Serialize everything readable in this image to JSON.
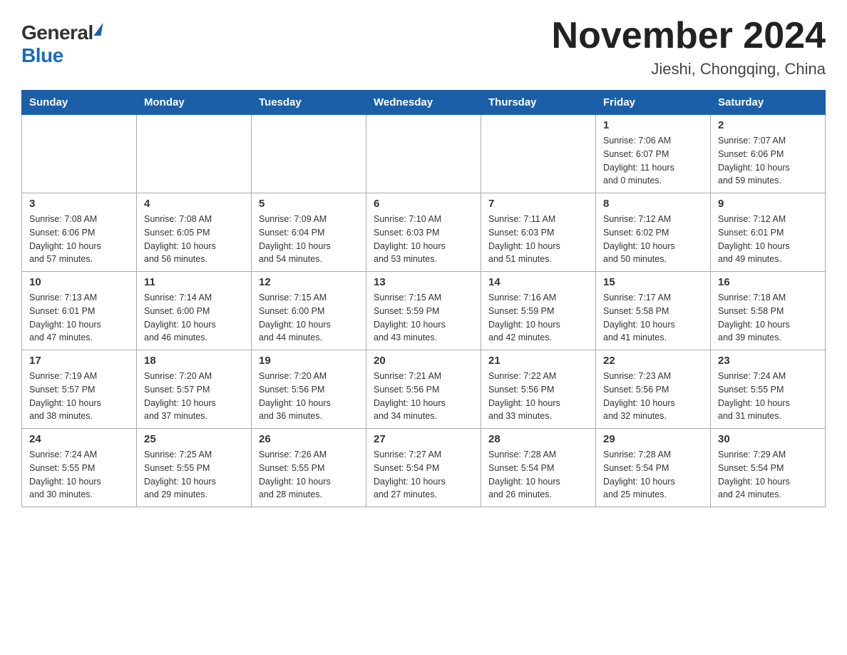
{
  "header": {
    "logo_general": "General",
    "logo_blue": "Blue",
    "month_title": "November 2024",
    "location": "Jieshi, Chongqing, China"
  },
  "weekdays": [
    "Sunday",
    "Monday",
    "Tuesday",
    "Wednesday",
    "Thursday",
    "Friday",
    "Saturday"
  ],
  "weeks": [
    [
      {
        "day": "",
        "info": ""
      },
      {
        "day": "",
        "info": ""
      },
      {
        "day": "",
        "info": ""
      },
      {
        "day": "",
        "info": ""
      },
      {
        "day": "",
        "info": ""
      },
      {
        "day": "1",
        "info": "Sunrise: 7:06 AM\nSunset: 6:07 PM\nDaylight: 11 hours\nand 0 minutes."
      },
      {
        "day": "2",
        "info": "Sunrise: 7:07 AM\nSunset: 6:06 PM\nDaylight: 10 hours\nand 59 minutes."
      }
    ],
    [
      {
        "day": "3",
        "info": "Sunrise: 7:08 AM\nSunset: 6:06 PM\nDaylight: 10 hours\nand 57 minutes."
      },
      {
        "day": "4",
        "info": "Sunrise: 7:08 AM\nSunset: 6:05 PM\nDaylight: 10 hours\nand 56 minutes."
      },
      {
        "day": "5",
        "info": "Sunrise: 7:09 AM\nSunset: 6:04 PM\nDaylight: 10 hours\nand 54 minutes."
      },
      {
        "day": "6",
        "info": "Sunrise: 7:10 AM\nSunset: 6:03 PM\nDaylight: 10 hours\nand 53 minutes."
      },
      {
        "day": "7",
        "info": "Sunrise: 7:11 AM\nSunset: 6:03 PM\nDaylight: 10 hours\nand 51 minutes."
      },
      {
        "day": "8",
        "info": "Sunrise: 7:12 AM\nSunset: 6:02 PM\nDaylight: 10 hours\nand 50 minutes."
      },
      {
        "day": "9",
        "info": "Sunrise: 7:12 AM\nSunset: 6:01 PM\nDaylight: 10 hours\nand 49 minutes."
      }
    ],
    [
      {
        "day": "10",
        "info": "Sunrise: 7:13 AM\nSunset: 6:01 PM\nDaylight: 10 hours\nand 47 minutes."
      },
      {
        "day": "11",
        "info": "Sunrise: 7:14 AM\nSunset: 6:00 PM\nDaylight: 10 hours\nand 46 minutes."
      },
      {
        "day": "12",
        "info": "Sunrise: 7:15 AM\nSunset: 6:00 PM\nDaylight: 10 hours\nand 44 minutes."
      },
      {
        "day": "13",
        "info": "Sunrise: 7:15 AM\nSunset: 5:59 PM\nDaylight: 10 hours\nand 43 minutes."
      },
      {
        "day": "14",
        "info": "Sunrise: 7:16 AM\nSunset: 5:59 PM\nDaylight: 10 hours\nand 42 minutes."
      },
      {
        "day": "15",
        "info": "Sunrise: 7:17 AM\nSunset: 5:58 PM\nDaylight: 10 hours\nand 41 minutes."
      },
      {
        "day": "16",
        "info": "Sunrise: 7:18 AM\nSunset: 5:58 PM\nDaylight: 10 hours\nand 39 minutes."
      }
    ],
    [
      {
        "day": "17",
        "info": "Sunrise: 7:19 AM\nSunset: 5:57 PM\nDaylight: 10 hours\nand 38 minutes."
      },
      {
        "day": "18",
        "info": "Sunrise: 7:20 AM\nSunset: 5:57 PM\nDaylight: 10 hours\nand 37 minutes."
      },
      {
        "day": "19",
        "info": "Sunrise: 7:20 AM\nSunset: 5:56 PM\nDaylight: 10 hours\nand 36 minutes."
      },
      {
        "day": "20",
        "info": "Sunrise: 7:21 AM\nSunset: 5:56 PM\nDaylight: 10 hours\nand 34 minutes."
      },
      {
        "day": "21",
        "info": "Sunrise: 7:22 AM\nSunset: 5:56 PM\nDaylight: 10 hours\nand 33 minutes."
      },
      {
        "day": "22",
        "info": "Sunrise: 7:23 AM\nSunset: 5:56 PM\nDaylight: 10 hours\nand 32 minutes."
      },
      {
        "day": "23",
        "info": "Sunrise: 7:24 AM\nSunset: 5:55 PM\nDaylight: 10 hours\nand 31 minutes."
      }
    ],
    [
      {
        "day": "24",
        "info": "Sunrise: 7:24 AM\nSunset: 5:55 PM\nDaylight: 10 hours\nand 30 minutes."
      },
      {
        "day": "25",
        "info": "Sunrise: 7:25 AM\nSunset: 5:55 PM\nDaylight: 10 hours\nand 29 minutes."
      },
      {
        "day": "26",
        "info": "Sunrise: 7:26 AM\nSunset: 5:55 PM\nDaylight: 10 hours\nand 28 minutes."
      },
      {
        "day": "27",
        "info": "Sunrise: 7:27 AM\nSunset: 5:54 PM\nDaylight: 10 hours\nand 27 minutes."
      },
      {
        "day": "28",
        "info": "Sunrise: 7:28 AM\nSunset: 5:54 PM\nDaylight: 10 hours\nand 26 minutes."
      },
      {
        "day": "29",
        "info": "Sunrise: 7:28 AM\nSunset: 5:54 PM\nDaylight: 10 hours\nand 25 minutes."
      },
      {
        "day": "30",
        "info": "Sunrise: 7:29 AM\nSunset: 5:54 PM\nDaylight: 10 hours\nand 24 minutes."
      }
    ]
  ]
}
